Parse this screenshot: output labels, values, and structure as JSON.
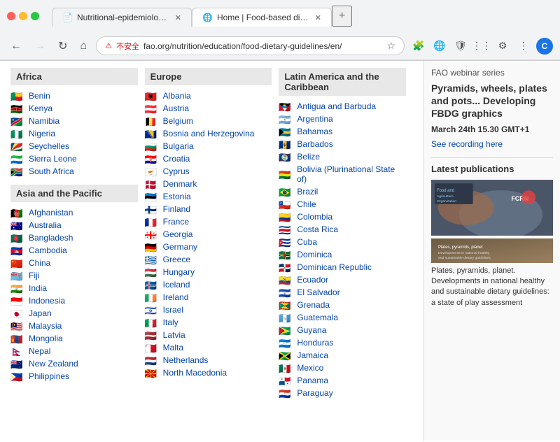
{
  "browser": {
    "tabs": [
      {
        "label": "Nutritional-epidemiologic-onto...",
        "active": false,
        "favicon": "📄"
      },
      {
        "label": "Home | Food-based dietary gu...",
        "active": true,
        "favicon": "🌐"
      }
    ],
    "address": "fao.org/nutrition/education/food-dietary-guidelines/en/",
    "lock_text": "不安全",
    "new_tab_label": "+"
  },
  "regions": [
    {
      "name": "Africa",
      "countries": [
        {
          "name": "Benin",
          "flag": "🇧🇯"
        },
        {
          "name": "Kenya",
          "flag": "🇰🇪"
        },
        {
          "name": "Namibia",
          "flag": "🇳🇦"
        },
        {
          "name": "Nigeria",
          "flag": "🇳🇬"
        },
        {
          "name": "Seychelles",
          "flag": "🇸🇨"
        },
        {
          "name": "Sierra Leone",
          "flag": "🇸🇱"
        },
        {
          "name": "South Africa",
          "flag": "🇿🇦"
        }
      ]
    },
    {
      "name": "Asia and the Pacific",
      "countries": [
        {
          "name": "Afghanistan",
          "flag": "🇦🇫"
        },
        {
          "name": "Australia",
          "flag": "🇦🇺"
        },
        {
          "name": "Bangladesh",
          "flag": "🇧🇩"
        },
        {
          "name": "Cambodia",
          "flag": "🇰🇭"
        },
        {
          "name": "China",
          "flag": "🇨🇳"
        },
        {
          "name": "Fiji",
          "flag": "🇫🇯"
        },
        {
          "name": "India",
          "flag": "🇮🇳"
        },
        {
          "name": "Indonesia",
          "flag": "🇮🇩"
        },
        {
          "name": "Japan",
          "flag": "🇯🇵"
        },
        {
          "name": "Malaysia",
          "flag": "🇲🇾"
        },
        {
          "name": "Mongolia",
          "flag": "🇲🇳"
        },
        {
          "name": "Nepal",
          "flag": "🇳🇵"
        },
        {
          "name": "New Zealand",
          "flag": "🇳🇿"
        },
        {
          "name": "Philippines",
          "flag": "🇵🇭"
        }
      ]
    }
  ],
  "europe_region": {
    "name": "Europe",
    "countries": [
      {
        "name": "Albania",
        "flag": "🇦🇱"
      },
      {
        "name": "Austria",
        "flag": "🇦🇹"
      },
      {
        "name": "Belgium",
        "flag": "🇧🇪"
      },
      {
        "name": "Bosnia and Herzegovina",
        "flag": "🇧🇦"
      },
      {
        "name": "Bulgaria",
        "flag": "🇧🇬"
      },
      {
        "name": "Croatia",
        "flag": "🇭🇷"
      },
      {
        "name": "Cyprus",
        "flag": "🇨🇾"
      },
      {
        "name": "Denmark",
        "flag": "🇩🇰"
      },
      {
        "name": "Estonia",
        "flag": "🇪🇪"
      },
      {
        "name": "Finland",
        "flag": "🇫🇮"
      },
      {
        "name": "France",
        "flag": "🇫🇷"
      },
      {
        "name": "Georgia",
        "flag": "🇬🇪"
      },
      {
        "name": "Germany",
        "flag": "🇩🇪"
      },
      {
        "name": "Greece",
        "flag": "🇬🇷"
      },
      {
        "name": "Hungary",
        "flag": "🇭🇺"
      },
      {
        "name": "Iceland",
        "flag": "🇮🇸"
      },
      {
        "name": "Ireland",
        "flag": "🇮🇪"
      },
      {
        "name": "Israel",
        "flag": "🇮🇱"
      },
      {
        "name": "Italy",
        "flag": "🇮🇹"
      },
      {
        "name": "Latvia",
        "flag": "🇱🇻"
      },
      {
        "name": "Malta",
        "flag": "🇲🇹"
      },
      {
        "name": "Netherlands",
        "flag": "🇳🇱"
      },
      {
        "name": "North Macedonia",
        "flag": "🇲🇰"
      }
    ]
  },
  "latam_region": {
    "name": "Latin America and the Caribbean",
    "countries": [
      {
        "name": "Antigua and Barbuda",
        "flag": "🇦🇬"
      },
      {
        "name": "Argentina",
        "flag": "🇦🇷"
      },
      {
        "name": "Bahamas",
        "flag": "🇧🇸"
      },
      {
        "name": "Barbados",
        "flag": "🇧🇧"
      },
      {
        "name": "Belize",
        "flag": "🇧🇿"
      },
      {
        "name": "Bolivia (Plurinational State of)",
        "flag": "🇧🇴"
      },
      {
        "name": "Brazil",
        "flag": "🇧🇷"
      },
      {
        "name": "Chile",
        "flag": "🇨🇱"
      },
      {
        "name": "Colombia",
        "flag": "🇨🇴"
      },
      {
        "name": "Costa Rica",
        "flag": "🇨🇷"
      },
      {
        "name": "Cuba",
        "flag": "🇨🇺"
      },
      {
        "name": "Dominica",
        "flag": "🇩🇲"
      },
      {
        "name": "Dominican Republic",
        "flag": "🇩🇴"
      },
      {
        "name": "Ecuador",
        "flag": "🇪🇨"
      },
      {
        "name": "El Salvador",
        "flag": "🇸🇻"
      },
      {
        "name": "Grenada",
        "flag": "🇬🇩"
      },
      {
        "name": "Guatemala",
        "flag": "🇬🇹"
      },
      {
        "name": "Guyana",
        "flag": "🇬🇾"
      },
      {
        "name": "Honduras",
        "flag": "🇭🇳"
      },
      {
        "name": "Jamaica",
        "flag": "🇯🇲"
      },
      {
        "name": "Mexico",
        "flag": "🇲🇽"
      },
      {
        "name": "Panama",
        "flag": "🇵🇦"
      },
      {
        "name": "Paraguay",
        "flag": "🇵🇾"
      }
    ]
  },
  "sidebar": {
    "webinar_series": "FAO webinar series",
    "webinar_heading": "Pyramids, wheels, plates and pots... Developing FBDG graphics",
    "webinar_date": "March 24th 15.30 GMT+1",
    "webinar_link": "See recording here",
    "publications_heading": "Latest publications",
    "pub1_title": "Plates, pyramids, planet. Developments in national healthy and sustainable dietary guidelines: a state of play assessment",
    "pub1_desc": "Plates, pyramids, planet. Developments in national healthy and sustainable dietary guidelines: a state of play assessment"
  }
}
